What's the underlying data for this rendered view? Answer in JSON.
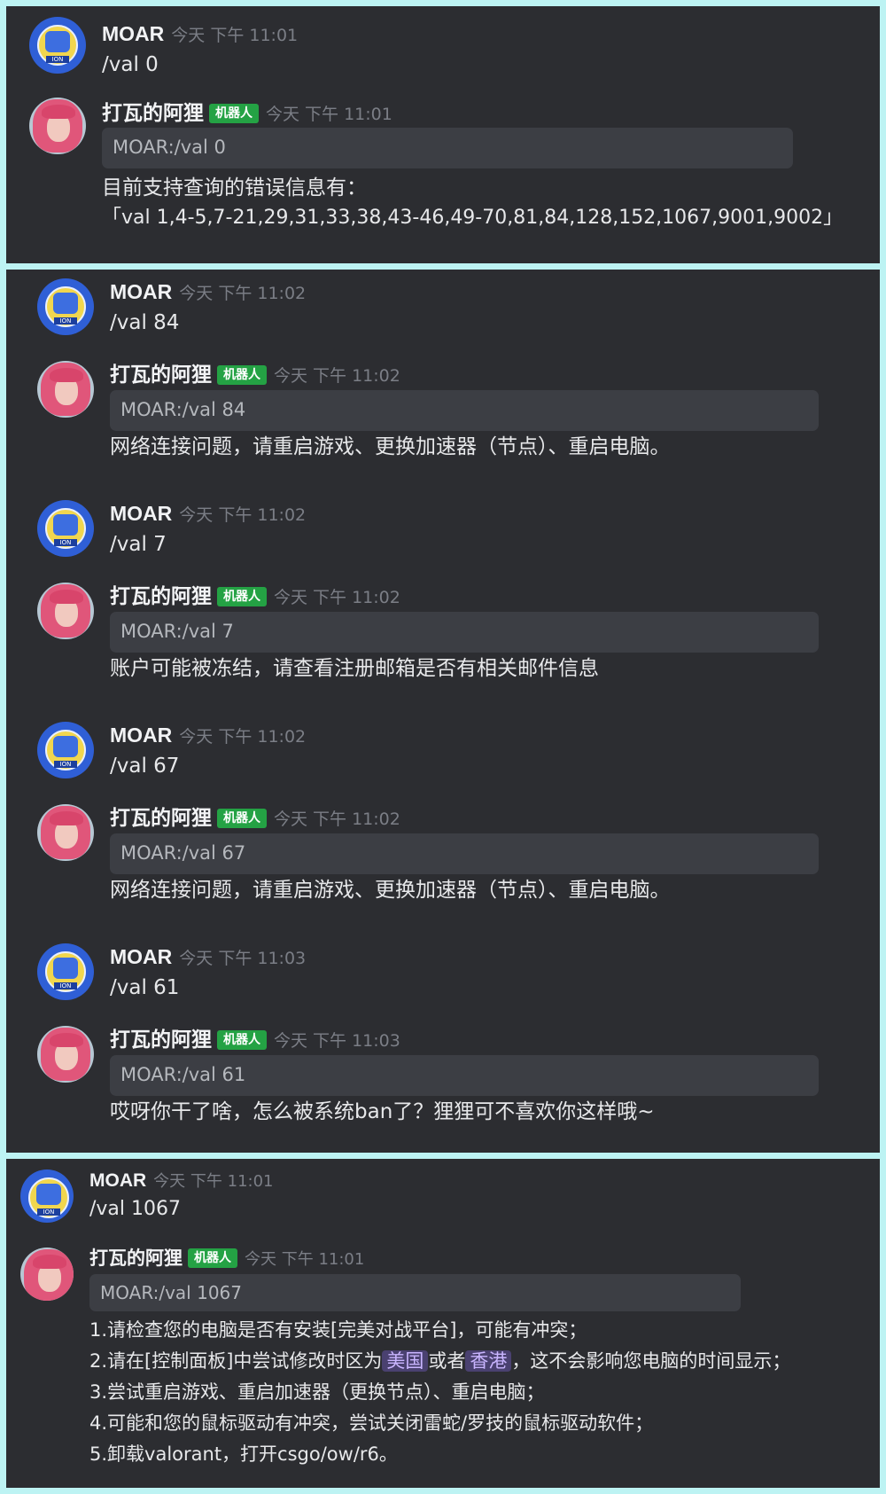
{
  "panels": [
    {
      "messages": [
        {
          "author": "MOAR",
          "timestamp": "今天 下午 11:01",
          "content": "/val 0",
          "avatar": "moar-logo-avatar"
        },
        {
          "author": "打瓦的阿狸",
          "badge": "机器人",
          "timestamp": "今天 下午 11:01",
          "quote": "MOAR:/val 0",
          "lines": [
            "目前支持查询的错误信息有：",
            "「val 1,4-5,7-21,29,31,33,38,43-46,49-70,81,84,128,152,1067,9001,9002」"
          ],
          "avatar": "ahri-avatar"
        }
      ]
    },
    {
      "messages": [
        {
          "author": "MOAR",
          "timestamp": "今天 下午 11:02",
          "content": "/val 84",
          "avatar": "moar-logo-avatar"
        },
        {
          "author": "打瓦的阿狸",
          "badge": "机器人",
          "timestamp": "今天 下午 11:02",
          "quote": "MOAR:/val 84",
          "lines": [
            "网络连接问题，请重启游戏、更换加速器（节点）、重启电脑。"
          ],
          "avatar": "ahri-avatar"
        },
        {
          "author": "MOAR",
          "timestamp": "今天 下午 11:02",
          "content": "/val 7",
          "avatar": "moar-logo-avatar"
        },
        {
          "author": "打瓦的阿狸",
          "badge": "机器人",
          "timestamp": "今天 下午 11:02",
          "quote": "MOAR:/val 7",
          "lines": [
            "账户可能被冻结，请查看注册邮箱是否有相关邮件信息"
          ],
          "avatar": "ahri-avatar"
        },
        {
          "author": "MOAR",
          "timestamp": "今天 下午 11:02",
          "content": "/val 67",
          "avatar": "moar-logo-avatar"
        },
        {
          "author": "打瓦的阿狸",
          "badge": "机器人",
          "timestamp": "今天 下午 11:02",
          "quote": "MOAR:/val 67",
          "lines": [
            "网络连接问题，请重启游戏、更换加速器（节点）、重启电脑。"
          ],
          "avatar": "ahri-avatar"
        },
        {
          "author": "MOAR",
          "timestamp": "今天 下午 11:03",
          "content": "/val 61",
          "avatar": "moar-logo-avatar"
        },
        {
          "author": "打瓦的阿狸",
          "badge": "机器人",
          "timestamp": "今天 下午 11:03",
          "quote": "MOAR:/val 61",
          "lines": [
            "哎呀你干了啥，怎么被系统ban了？狸狸可不喜欢你这样哦~"
          ],
          "avatar": "ahri-avatar"
        }
      ]
    },
    {
      "messages": [
        {
          "author": "MOAR",
          "timestamp": "今天 下午 11:01",
          "content": "/val 1067",
          "avatar": "moar-logo-avatar"
        },
        {
          "author": "打瓦的阿狸",
          "badge": "机器人",
          "timestamp": "今天 下午 11:01",
          "quote": "MOAR:/val 1067",
          "lines": [
            "1.请检查您的电脑是否有安装[完美对战平台]，可能有冲突；",
            {
              "before": "2.请在[控制面板]中尝试修改时区为",
              "chip1": "美国",
              "middle": "或者",
              "chip2": "香港",
              "after": "，这不会影响您电脑的时间显示；"
            },
            "3.尝试重启游戏、重启加速器（更换节点）、重启电脑；",
            "4.可能和您的鼠标驱动有冲突，尝试关闭雷蛇/罗技的鼠标驱动软件；",
            "5.卸载valorant，打开csgo/ow/r6。"
          ],
          "avatar": "ahri-avatar"
        }
      ]
    }
  ],
  "colors": {
    "background": "#bdf3f3",
    "panel": "#2c2d31",
    "badge": "#24a244",
    "quote": "#3c3e44",
    "timestamp": "#7b7e86"
  }
}
